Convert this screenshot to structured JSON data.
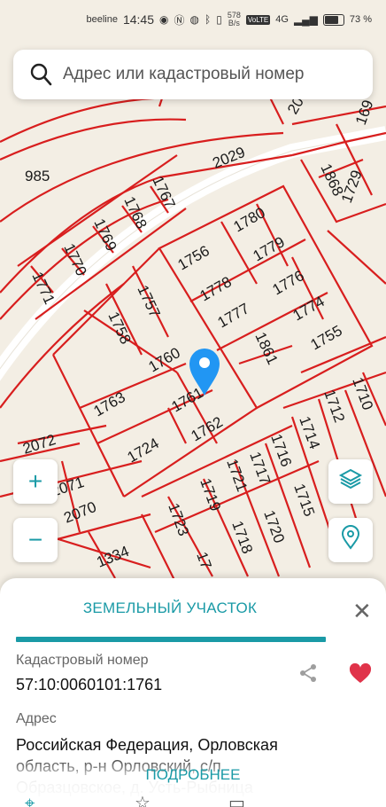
{
  "statusbar": {
    "carrier": "beeline",
    "time": "14:45",
    "rate_value": "578",
    "rate_unit": "B/s",
    "volte": "VoLTE",
    "network": "4G",
    "battery": "73 %",
    "icons": [
      "whatsapp-icon",
      "nfc-icon",
      "app-icon",
      "bluetooth-icon",
      "vibrate-icon",
      "signal-icon",
      "battery-icon"
    ]
  },
  "search": {
    "placeholder": "Адрес или кадастровый номер",
    "icon": "search-icon"
  },
  "map": {
    "parcels": [
      "985",
      "2029",
      "1868",
      "2072",
      "2071",
      "2070",
      "1334",
      "1771",
      "1770",
      "1769",
      "1768",
      "1767",
      "1756",
      "1780",
      "1779",
      "1778",
      "1776",
      "1777",
      "1774",
      "1755",
      "1757",
      "1758",
      "1760",
      "1763",
      "1761",
      "1762",
      "1724",
      "1861",
      "1710",
      "1712",
      "1714",
      "1716",
      "1717",
      "1715",
      "1721",
      "1719",
      "1720",
      "1718",
      "1723",
      "1729",
      "169",
      "20",
      "17"
    ],
    "colors": {
      "background": "#f3eee4",
      "lines": "#d81e1e",
      "road": "#ffffff",
      "pin": "#2196f3"
    }
  },
  "controls": {
    "zoom_in": "+",
    "zoom_out": "−",
    "layers_icon": "layers-icon",
    "location_icon": "location-pin-icon"
  },
  "sheet": {
    "title": "ЗЕМЕЛЬНЫЙ УЧАСТОК",
    "cadastral_label": "Кадастровый номер",
    "cadastral_value": "57:10:0060101:1761",
    "address_label": "Адрес",
    "address_value": "Российская Федерация, Орловская область, р-н Орловский, с/п Образцовское, д. Усть-Рыбница",
    "more": "ПОДРОБНЕЕ",
    "accent": "#1a9aa6",
    "favorite_color": "#e0334a"
  }
}
